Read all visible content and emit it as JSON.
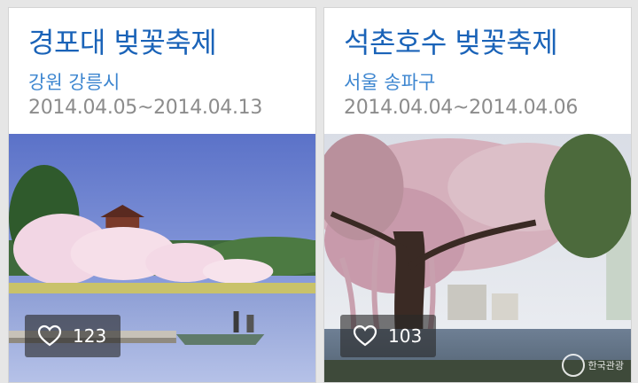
{
  "cards": [
    {
      "title": "경포대 벚꽃축제",
      "location": "강원 강릉시",
      "dates": "2014.04.05~2014.04.13",
      "likes": "123",
      "photo_icon": "cherry-blossom-lake-photo",
      "like_icon": "heart-outline-icon"
    },
    {
      "title": "석촌호수 벚꽃축제",
      "location": "서울 송파구",
      "dates": "2014.04.04~2014.04.06",
      "likes": "103",
      "photo_icon": "cherry-blossom-tree-photo",
      "like_icon": "heart-outline-icon",
      "watermark": "한국관광"
    }
  ],
  "colors": {
    "title": "#1a63b8",
    "location": "#3d86d0",
    "dates": "#8c8c8c",
    "background": "#e6e6e6"
  }
}
